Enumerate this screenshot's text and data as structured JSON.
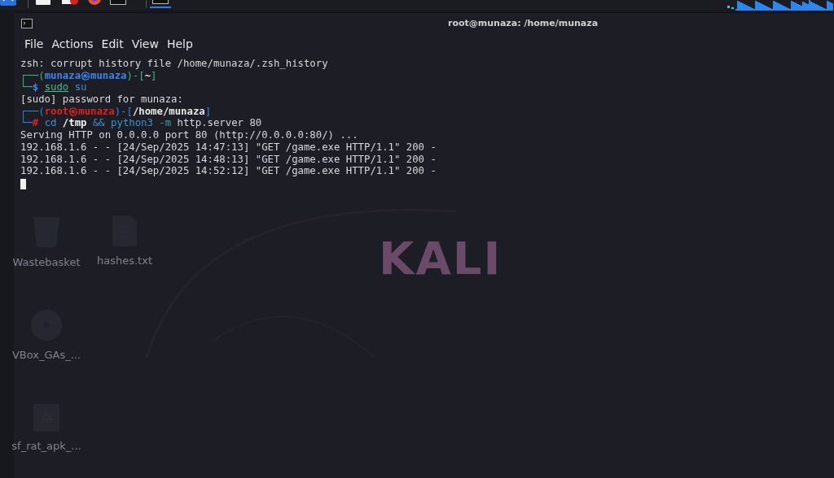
{
  "taskbar": {
    "apps": [
      {
        "kind": "dragon",
        "selected": false
      },
      {
        "kind": "window",
        "selected": false
      },
      {
        "kind": "editor",
        "selected": false
      },
      {
        "kind": "browser",
        "selected": false
      },
      {
        "kind": "terminal",
        "selected": false
      },
      {
        "kind": "terminal",
        "selected": true
      }
    ]
  },
  "desktop": {
    "wallpaper_text": "KALI",
    "icons": [
      {
        "kind": "trash",
        "label": "Wastebasket"
      },
      {
        "kind": "file",
        "label": "hashes.txt"
      },
      {
        "kind": "disc",
        "label": "VBox_GAs_..."
      },
      {
        "kind": "drive",
        "label": "sf_rat_apk_..."
      }
    ]
  },
  "window": {
    "title": "root@munaza: /home/munaza",
    "menu": [
      "File",
      "Actions",
      "Edit",
      "View",
      "Help"
    ]
  },
  "terminal": {
    "lines": [
      {
        "kind": "output",
        "text": "zsh: corrupt history file /home/munaza/.zsh_history"
      },
      {
        "kind": "prompt",
        "root": false,
        "lead": "┌──(",
        "user": "munaza",
        "at": "㉿",
        "host": "munaza",
        "mid": ")-[",
        "path": "~",
        "tail": "]"
      },
      {
        "kind": "command",
        "root": false,
        "lead": "└─",
        "symbol": "$",
        "tokens": [
          {
            "kind": "precommand",
            "text": "sudo"
          },
          {
            "kind": "command",
            "text": "su"
          }
        ]
      },
      {
        "kind": "output",
        "text": "[sudo] password for munaza:"
      },
      {
        "kind": "prompt",
        "root": true,
        "lead": "┌──(",
        "user": "root",
        "at": "㉿",
        "host": "munaza",
        "mid": ")-[",
        "path": "/home/munaza",
        "tail": "]"
      },
      {
        "kind": "command",
        "root": true,
        "lead": "└─",
        "symbol": "#",
        "tokens": [
          {
            "kind": "command",
            "text": "cd"
          },
          {
            "kind": "path",
            "text": "/tmp"
          },
          {
            "kind": "operator",
            "text": "&&"
          },
          {
            "kind": "command",
            "text": "python3"
          },
          {
            "kind": "option",
            "text": "-m"
          },
          {
            "kind": "plain",
            "text": "http.server 80"
          }
        ]
      },
      {
        "kind": "output",
        "text": "Serving HTTP on 0.0.0.0 port 80 (http://0.0.0.0:80/) ..."
      },
      {
        "kind": "output",
        "text": "192.168.1.6 - - [24/Sep/2025 14:47:13] \"GET /game.exe HTTP/1.1\" 200 -"
      },
      {
        "kind": "output",
        "text": "192.168.1.6 - - [24/Sep/2025 14:48:13] \"GET /game.exe HTTP/1.1\" 200 -"
      },
      {
        "kind": "output",
        "text": "192.168.1.6 - - [24/Sep/2025 14:52:12] \"GET /game.exe HTTP/1.1\" 200 -"
      }
    ]
  }
}
